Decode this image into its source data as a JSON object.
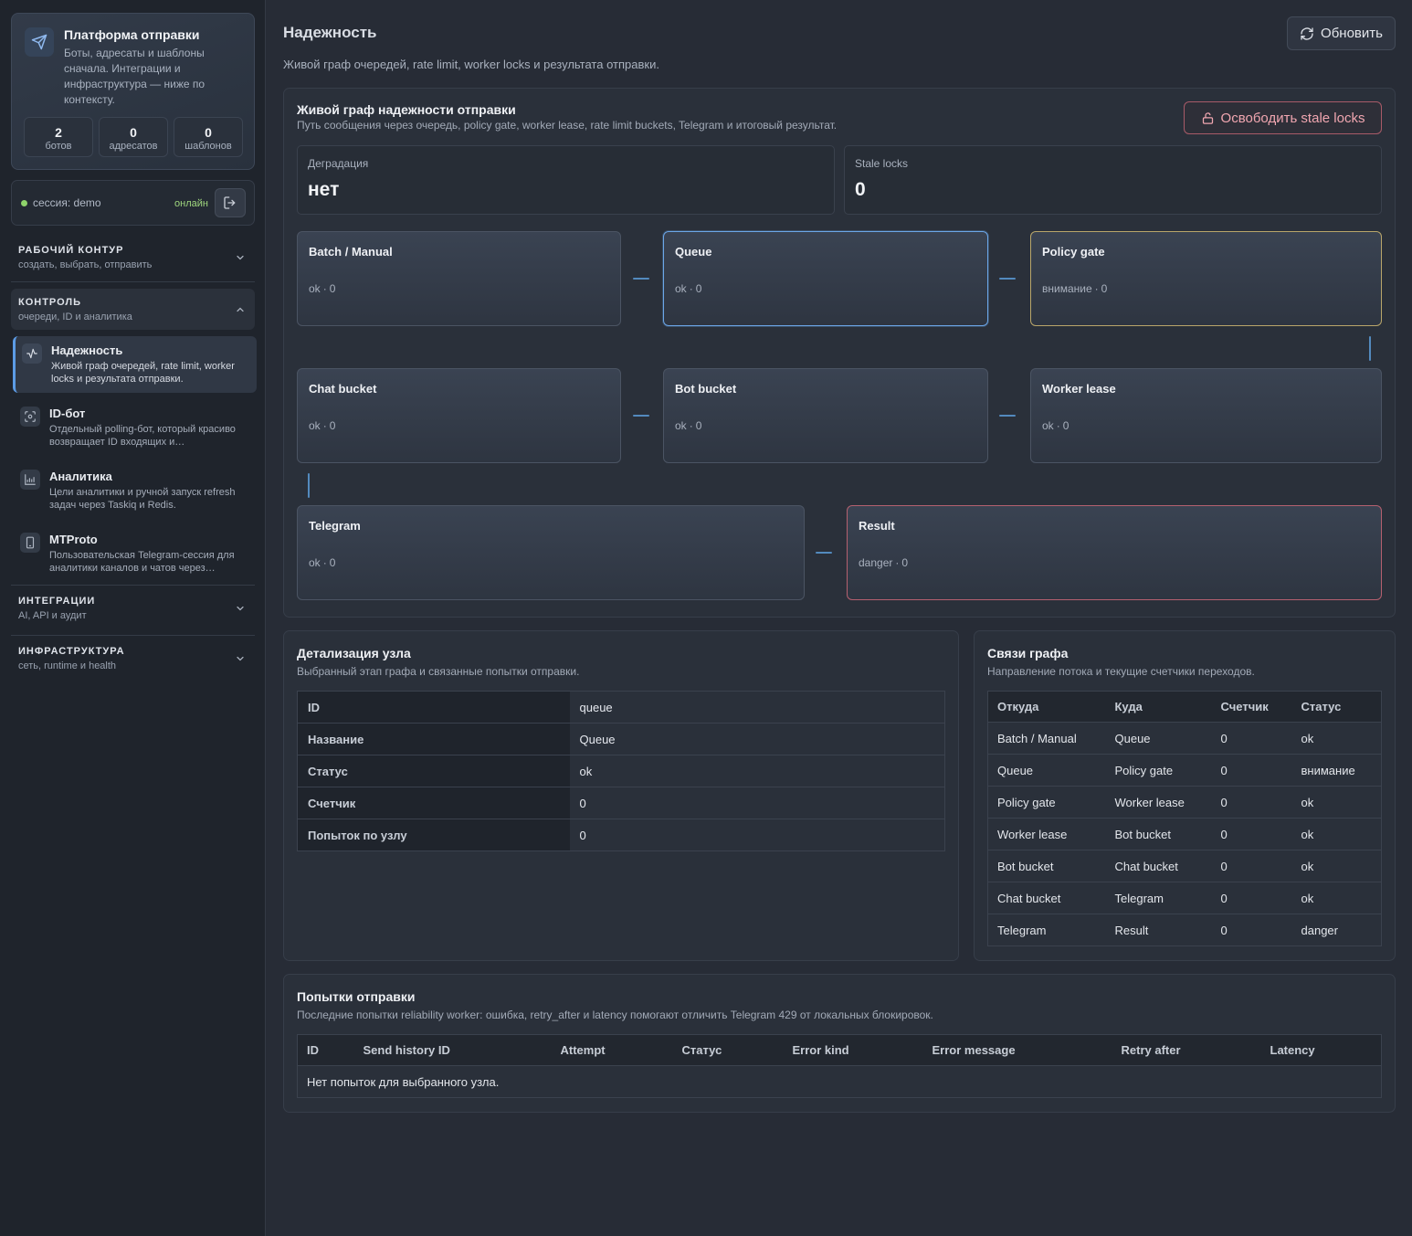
{
  "sidebar": {
    "brand": {
      "title": "Платформа отправки",
      "description": "Боты, адресаты и шаблоны сначала. Интеграции и инфраструктура — ниже по контексту.",
      "stats": [
        {
          "value": "2",
          "label": "ботов"
        },
        {
          "value": "0",
          "label": "адресатов"
        },
        {
          "value": "0",
          "label": "шаблонов"
        }
      ]
    },
    "session": {
      "text": "сессия: demo",
      "status": "онлайн"
    },
    "groups": {
      "workflow": {
        "title": "РАБОЧИЙ КОНТУР",
        "subtitle": "создать, выбрать, отправить"
      },
      "control": {
        "title": "КОНТРОЛЬ",
        "subtitle": "очереди, ID и аналитика"
      },
      "integrations": {
        "title": "ИНТЕГРАЦИИ",
        "subtitle": "AI, API и аудит"
      },
      "infrastructure": {
        "title": "ИНФРАСТРУКТУРА",
        "subtitle": "сеть, runtime и health"
      }
    },
    "items": [
      {
        "title": "Надежность",
        "description": "Живой граф очередей, rate limit, worker locks и результата отправки.",
        "icon": "activity-icon"
      },
      {
        "title": "ID-бот",
        "description": "Отдельный polling-бот, который красиво возвращает ID входящих и…",
        "icon": "scan-icon"
      },
      {
        "title": "Аналитика",
        "description": "Цели аналитики и ручной запуск refresh задач через Taskiq и Redis.",
        "icon": "chart-icon"
      },
      {
        "title": "MTProto",
        "description": "Пользовательская Telegram-сессия для аналитики каналов и чатов через…",
        "icon": "phone-icon"
      }
    ]
  },
  "header": {
    "title": "Надежность",
    "subtitle": "Живой граф очередей, rate limit, worker locks и результата отправки.",
    "refresh_label": "Обновить"
  },
  "graph_panel": {
    "title": "Живой граф надежности отправки",
    "subtitle": "Путь сообщения через очередь, policy gate, worker lease, rate limit buckets, Telegram и итоговый результат.",
    "release_label": "Освободить stale locks",
    "metrics": [
      {
        "label": "Деградация",
        "value": "нет"
      },
      {
        "label": "Stale locks",
        "value": "0"
      }
    ],
    "nodes": [
      {
        "title": "Batch / Manual",
        "status": "ok",
        "count": "0"
      },
      {
        "title": "Queue",
        "status": "ok",
        "count": "0"
      },
      {
        "title": "Policy gate",
        "status": "внимание",
        "count": "0"
      },
      {
        "title": "Chat bucket",
        "status": "ok",
        "count": "0"
      },
      {
        "title": "Bot bucket",
        "status": "ok",
        "count": "0"
      },
      {
        "title": "Worker lease",
        "status": "ok",
        "count": "0"
      },
      {
        "title": "Telegram",
        "status": "ok",
        "count": "0"
      },
      {
        "title": "Result",
        "status": "danger",
        "count": "0"
      }
    ]
  },
  "node_detail": {
    "title": "Детализация узла",
    "subtitle": "Выбранный этап графа и связанные попытки отправки.",
    "rows": [
      {
        "key": "ID",
        "value": "queue"
      },
      {
        "key": "Название",
        "value": "Queue"
      },
      {
        "key": "Статус",
        "value": "ok"
      },
      {
        "key": "Счетчик",
        "value": "0"
      },
      {
        "key": "Попыток по узлу",
        "value": "0"
      }
    ]
  },
  "graph_links": {
    "title": "Связи графа",
    "subtitle": "Направление потока и текущие счетчики переходов.",
    "columns": [
      "Откуда",
      "Куда",
      "Счетчик",
      "Статус"
    ],
    "rows": [
      [
        "Batch / Manual",
        "Queue",
        "0",
        "ok"
      ],
      [
        "Queue",
        "Policy gate",
        "0",
        "внимание"
      ],
      [
        "Policy gate",
        "Worker lease",
        "0",
        "ok"
      ],
      [
        "Worker lease",
        "Bot bucket",
        "0",
        "ok"
      ],
      [
        "Bot bucket",
        "Chat bucket",
        "0",
        "ok"
      ],
      [
        "Chat bucket",
        "Telegram",
        "0",
        "ok"
      ],
      [
        "Telegram",
        "Result",
        "0",
        "danger"
      ]
    ]
  },
  "attempts": {
    "title": "Попытки отправки",
    "subtitle": "Последние попытки reliability worker: ошибка, retry_after и latency помогают отличить Telegram 429 от локальных блокировок.",
    "columns": [
      "ID",
      "Send history ID",
      "Attempt",
      "Статус",
      "Error kind",
      "Error message",
      "Retry after",
      "Latency"
    ],
    "empty_text": "Нет попыток для выбранного узла."
  },
  "colors": {
    "accent": "#5c9ce6",
    "online": "#8fd46b",
    "warning": "#b9a66a",
    "danger": "#b5606f"
  }
}
